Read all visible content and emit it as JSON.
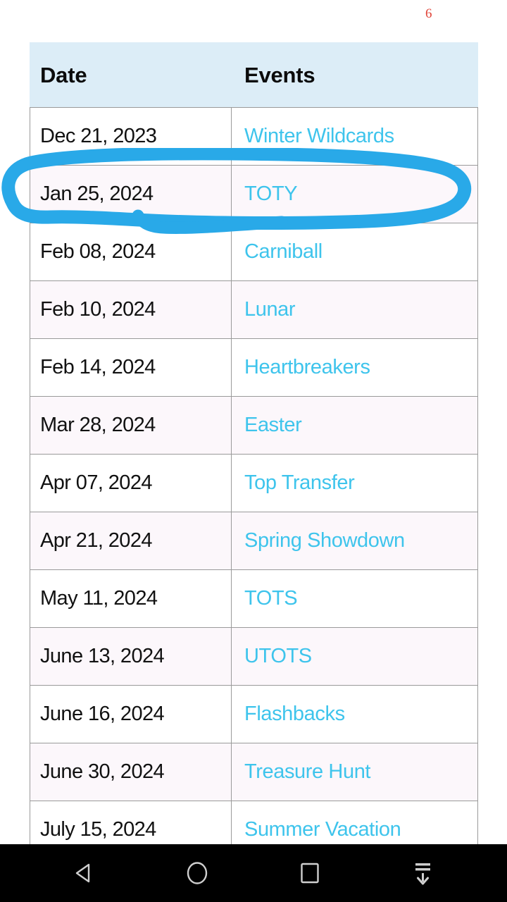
{
  "page": {
    "marker": "6",
    "marker_color": "#e0453a",
    "background": "#ffffff"
  },
  "table": {
    "header_background": "#dcedf7",
    "link_color": "#3ec4ec",
    "date_color": "#111111",
    "border_color": "#9a9a9a",
    "alt_row_background": "#fcf7fb",
    "columns": [
      "Date",
      "Events"
    ],
    "rows": [
      {
        "date": "Dec 21, 2023",
        "event": "Winter Wildcards"
      },
      {
        "date": "Jan 25, 2024",
        "event": "TOTY"
      },
      {
        "date": "Feb 08, 2024",
        "event": "Carniball"
      },
      {
        "date": "Feb 10, 2024",
        "event": "Lunar"
      },
      {
        "date": "Feb 14, 2024",
        "event": "Heartbreakers"
      },
      {
        "date": "Mar 28, 2024",
        "event": "Easter"
      },
      {
        "date": "Apr 07, 2024",
        "event": "Top Transfer"
      },
      {
        "date": "Apr 21, 2024",
        "event": "Spring Showdown"
      },
      {
        "date": "May 11, 2024",
        "event": "TOTS"
      },
      {
        "date": "June 13, 2024",
        "event": "UTOTS"
      },
      {
        "date": "June 16, 2024",
        "event": "Flashbacks"
      },
      {
        "date": "June 30, 2024",
        "event": "Treasure Hunt"
      },
      {
        "date": "July 15, 2024",
        "event": "Summer Vacation"
      }
    ]
  },
  "annotation": {
    "type": "hand-drawn-circle",
    "color": "#29a9e8",
    "target_row_index": 1,
    "target_date": "Jan 25, 2024",
    "target_event": "TOTY"
  },
  "nav_bar": {
    "background": "#000000",
    "buttons": [
      {
        "name": "back",
        "icon": "back-triangle-icon"
      },
      {
        "name": "home",
        "icon": "home-circle-icon"
      },
      {
        "name": "recents",
        "icon": "recents-square-icon"
      },
      {
        "name": "hide-keyboard",
        "icon": "hide-keyboard-icon"
      }
    ]
  }
}
